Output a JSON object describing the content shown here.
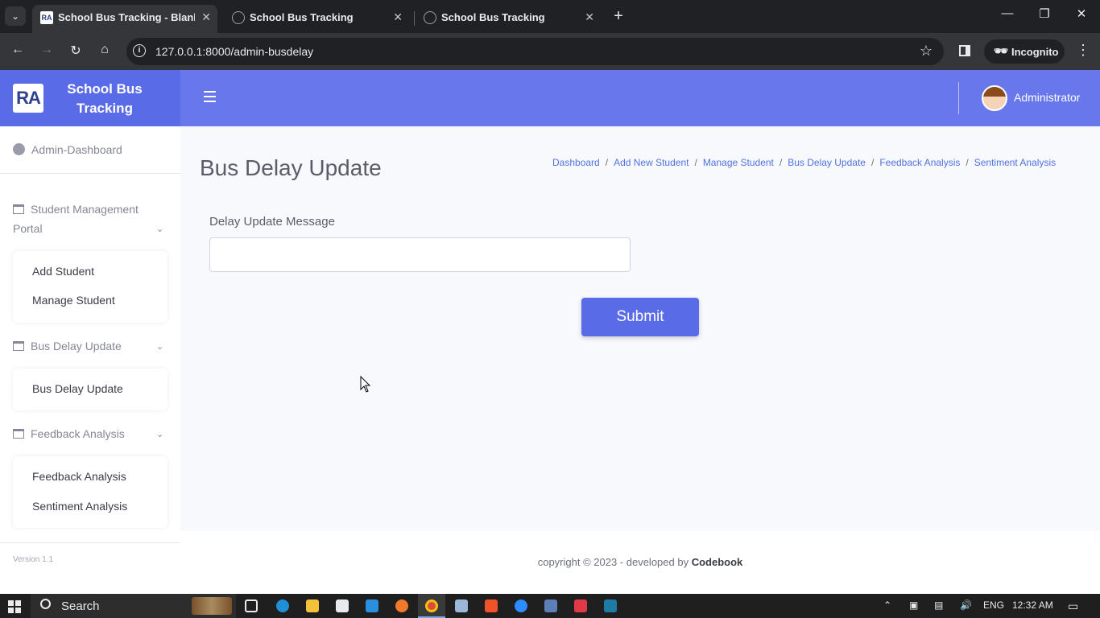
{
  "browser": {
    "tabs": [
      {
        "title": "School Bus Tracking - Blank Pa",
        "active": true,
        "favicon": "ra-logo"
      },
      {
        "title": "School Bus Tracking",
        "active": false,
        "favicon": "globe-icon"
      },
      {
        "title": "School Bus Tracking",
        "active": false,
        "favicon": "globe-icon"
      }
    ],
    "url": "127.0.0.1:8000/admin-busdelay",
    "incognito_label": "Incognito"
  },
  "brand": {
    "logo_text": "RA",
    "name": "School Bus Tracking",
    "color": "#5a6be8"
  },
  "sidebar": {
    "dashboard": "Admin-Dashboard",
    "sections": [
      {
        "label": "Student Management Portal",
        "items": [
          "Add Student",
          "Manage Student"
        ]
      },
      {
        "label": "Bus Delay Update",
        "items": [
          "Bus Delay Update"
        ]
      },
      {
        "label": "Feedback Analysis",
        "items": [
          "Feedback Analysis",
          "Sentiment Analysis"
        ]
      }
    ],
    "version": "Version 1.1"
  },
  "topbar": {
    "user_name": "Administrator",
    "color": "#6877ec"
  },
  "page": {
    "title": "Bus Delay Update",
    "breadcrumb": [
      "Dashboard",
      "Add New Student",
      "Manage Student",
      "Bus Delay Update",
      "Feedback Analysis",
      "Sentiment Analysis"
    ],
    "form": {
      "label": "Delay Update Message",
      "value": "",
      "submit_label": "Submit"
    }
  },
  "footer": {
    "text": "copyright © 2023 - developed by",
    "brand": "Codebook"
  },
  "taskbar": {
    "search_label": "Search",
    "language": "ENG",
    "time": "12:32 AM"
  }
}
